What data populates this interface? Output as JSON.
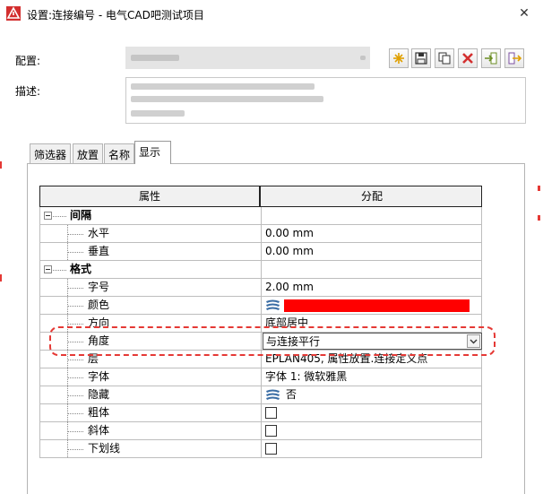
{
  "window": {
    "title": "设置:连接编号 - 电气CAD吧测试项目",
    "close_glyph": "✕"
  },
  "form": {
    "config_label": "配置:",
    "description_label": "描述:"
  },
  "toolbar": {
    "buttons": [
      {
        "name": "new-icon"
      },
      {
        "name": "save-icon"
      },
      {
        "name": "copy-icon"
      },
      {
        "name": "delete-icon"
      },
      {
        "name": "import-icon"
      },
      {
        "name": "export-icon"
      }
    ]
  },
  "tabs": [
    {
      "label": "筛选器",
      "active": false
    },
    {
      "label": "放置",
      "active": false
    },
    {
      "label": "名称",
      "active": false
    },
    {
      "label": "显示",
      "active": true
    }
  ],
  "grid": {
    "header": {
      "property": "属性",
      "value": "分配"
    },
    "rows": [
      {
        "type": "group",
        "label": "间隔",
        "value": ""
      },
      {
        "type": "item",
        "label": "水平",
        "value": "0.00 mm"
      },
      {
        "type": "item",
        "label": "垂直",
        "value": "0.00 mm"
      },
      {
        "type": "group",
        "label": "格式",
        "value": ""
      },
      {
        "type": "item",
        "label": "字号",
        "value": "2.00 mm"
      },
      {
        "type": "item",
        "label": "颜色",
        "value": "",
        "color": "#ff0000"
      },
      {
        "type": "item",
        "label": "方向",
        "value": "底部居中"
      },
      {
        "type": "item",
        "label": "角度",
        "value": "与连接平行",
        "combo": true
      },
      {
        "type": "item",
        "label": "层",
        "value": "EPLAN405, 属性放置.连接定义点"
      },
      {
        "type": "item",
        "label": "字体",
        "value": "字体 1: 微软雅黑"
      },
      {
        "type": "item",
        "label": "隐藏",
        "value": "否",
        "layer_icon": true
      },
      {
        "type": "item",
        "label": "粗体",
        "value": "",
        "checkbox": true
      },
      {
        "type": "item",
        "label": "斜体",
        "value": "",
        "checkbox": true
      },
      {
        "type": "item",
        "label": "下划线",
        "value": "",
        "checkbox": true
      }
    ]
  },
  "colors": {
    "highlight": "#e53935",
    "swatch": "#ff0000",
    "accent": "#c62828"
  }
}
